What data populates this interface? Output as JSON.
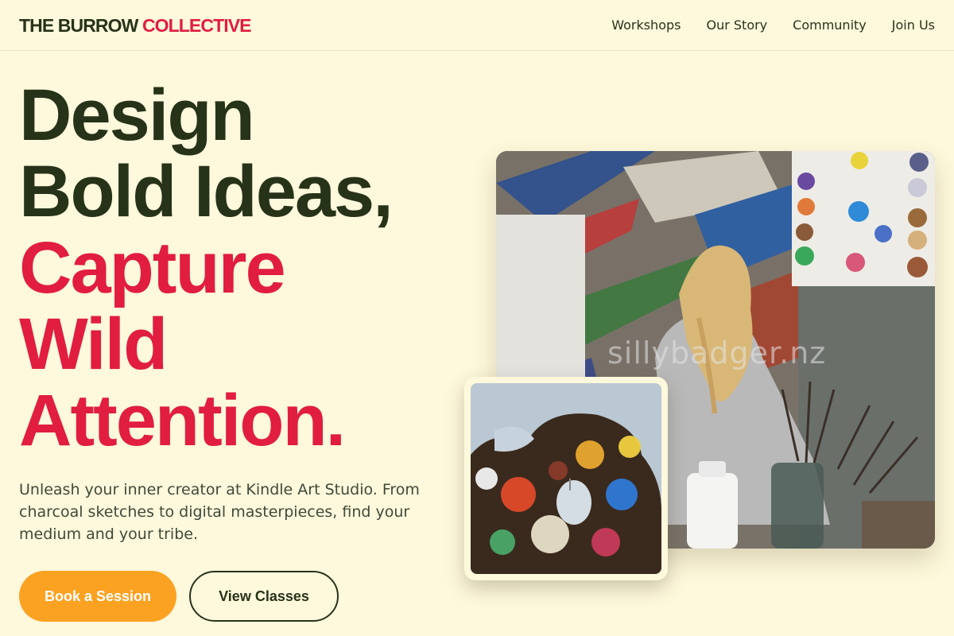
{
  "brand": {
    "name_part1": "THE BURROW",
    "name_part2": "COLLECTIVE"
  },
  "nav": {
    "items": [
      {
        "label": "Workshops"
      },
      {
        "label": "Our Story"
      },
      {
        "label": "Community"
      },
      {
        "label": "Join Us"
      }
    ]
  },
  "hero": {
    "headline_lines": [
      "Design",
      "Bold Ideas,",
      "Capture",
      "Wild",
      "Attention."
    ],
    "subtext": "Unleash your inner creator at Kindle Art Studio. From charcoal sketches to digital masterpieces, find your medium and your tribe.",
    "primary_cta": "Book a Session",
    "secondary_cta": "View Classes"
  },
  "images": {
    "main_watermark": "sillybadger.nz"
  },
  "colors": {
    "background": "#fef8dc",
    "dark_green": "#273319",
    "accent_red": "#e11d40",
    "accent_orange": "#fba222"
  }
}
